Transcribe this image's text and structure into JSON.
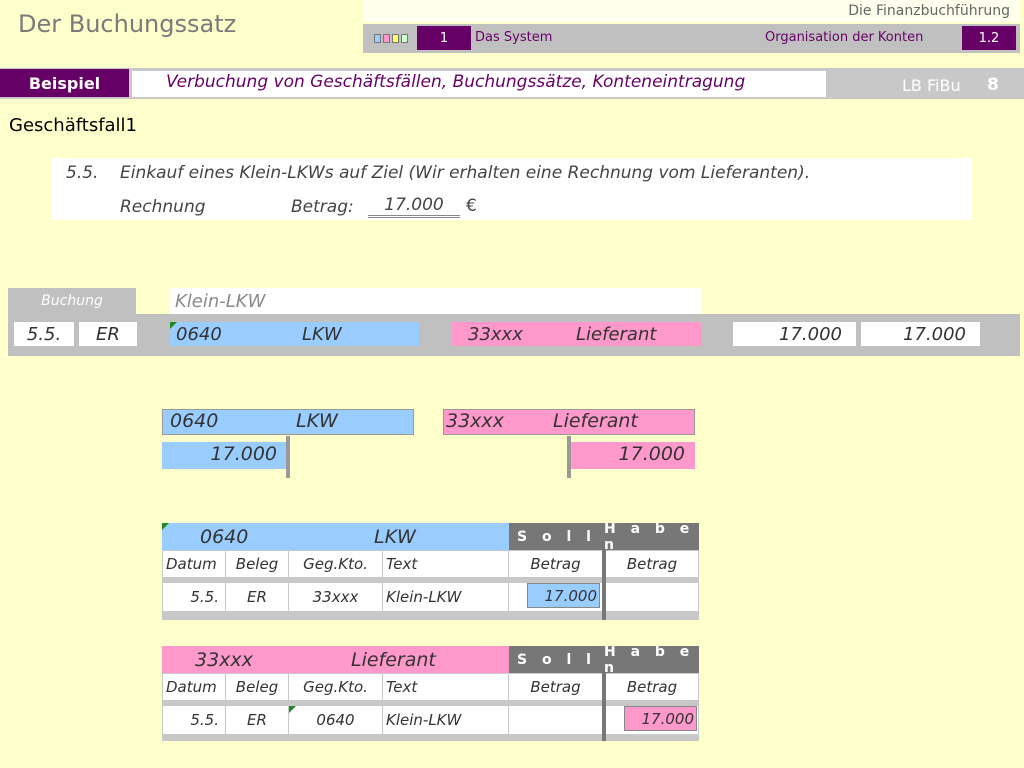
{
  "header": {
    "app_title": "Der Buchungssatz",
    "top_right": "Die Finanzbuchführung",
    "nav_number": "1",
    "nav_system": "Das System",
    "nav_org": "Organisation der Konten",
    "nav_section": "1.2"
  },
  "title_row": {
    "badge": "Beispiel",
    "subtitle": "Verbuchung von Geschäftsfällen, Buchungssätze, Konteneintragung",
    "lb_label": "LB FiBu",
    "lb_number": "8"
  },
  "heading": "Geschäftsfall1",
  "task": {
    "date": "5.5.",
    "description": "Einkauf eines Klein-LKWs auf Ziel (Wir erhalten eine Rechnung vom Lieferanten).",
    "doc_label": "Rechnung",
    "amount_label": "Betrag:",
    "amount": "17.000",
    "currency": "€"
  },
  "booking": {
    "tab": "Buchung",
    "text": "Klein-LKW",
    "date": "5.5.",
    "beleg": "ER",
    "debit_account": "0640",
    "debit_name": "LKW",
    "credit_account": "33xxx",
    "credit_name": "Lieferant",
    "debit_amount": "17.000",
    "credit_amount": "17.000"
  },
  "t_accounts": {
    "left": {
      "account": "0640",
      "name": "LKW",
      "amount": "17.000"
    },
    "right": {
      "account": "33xxx",
      "name": "Lieferant",
      "amount": "17.000"
    }
  },
  "ledger1": {
    "account": "0640",
    "name": "LKW",
    "soll": "S o l l",
    "haben": "H a b e n",
    "columns": [
      "Datum",
      "Beleg",
      "Geg.Kto.",
      "Text",
      "Betrag",
      "Betrag"
    ],
    "row": {
      "datum": "5.5.",
      "beleg": "ER",
      "gegkto": "33xxx",
      "text": "Klein-LKW",
      "soll": "17.000",
      "haben": ""
    }
  },
  "ledger2": {
    "account": "33xxx",
    "name": "Lieferant",
    "soll": "S o l l",
    "haben": "H a b e n",
    "columns": [
      "Datum",
      "Beleg",
      "Geg.Kto.",
      "Text",
      "Betrag",
      "Betrag"
    ],
    "row": {
      "datum": "5.5.",
      "beleg": "ER",
      "gegkto": "0640",
      "text": "Klein-LKW",
      "soll": "",
      "haben": "17.000"
    }
  },
  "colors": {
    "purple": "#660066",
    "blue": "#99ccff",
    "pink": "#ff99cc",
    "background": "#ffffcc"
  }
}
